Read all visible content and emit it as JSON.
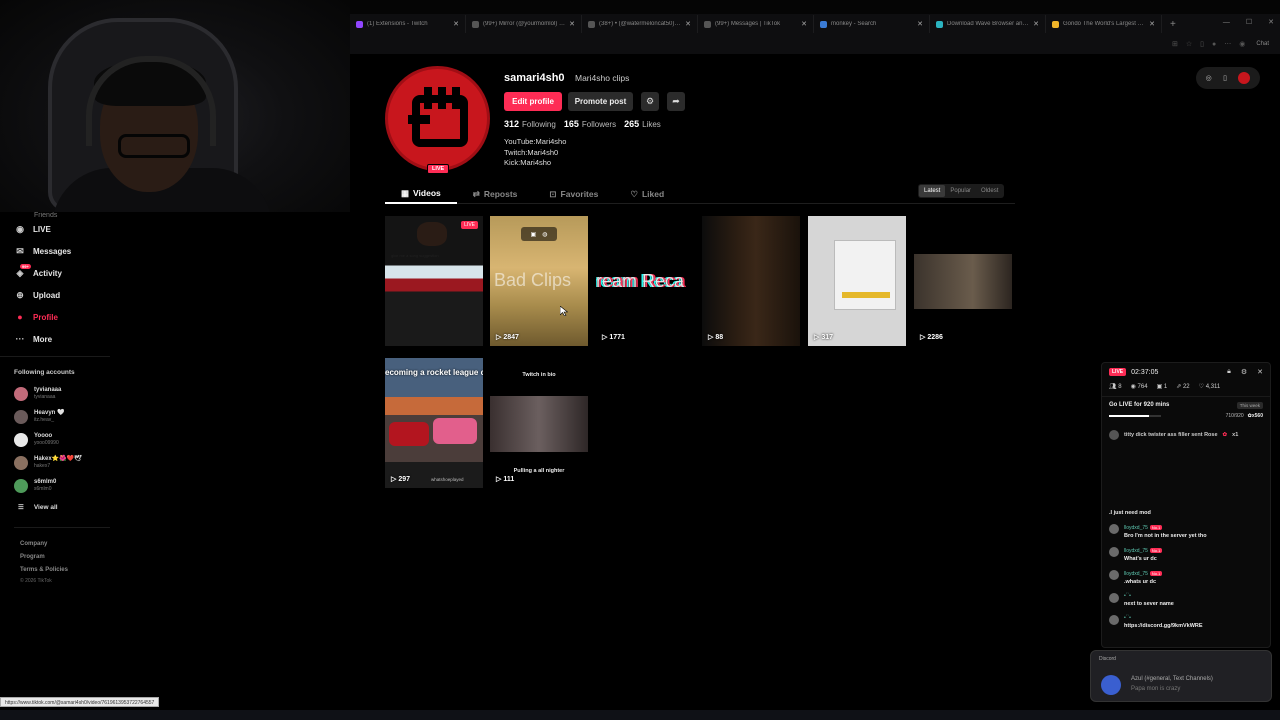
{
  "browser": {
    "tabs": [
      {
        "title": "(1) Extensions - Twitch",
        "color": "#9146ff"
      },
      {
        "title": "(99+) Mirror (@yourmomlol) | TikTok",
        "color": "#555555"
      },
      {
        "title": "(38+) • (@watermeloncat50) | TikTok",
        "color": "#555555"
      },
      {
        "title": "(99+) Messages | TikTok",
        "color": "#555555"
      },
      {
        "title": "monkey - Search",
        "color": "#3a7bd5"
      },
      {
        "title": "Download Wave Browser and Cl...",
        "color": "#2bb3c0"
      },
      {
        "title": "Gondo The World's Largest Sod...",
        "color": "#f0b429"
      }
    ],
    "new_tab": "+",
    "chat_ext": "Chat"
  },
  "sidebar": {
    "friends_label": "Friends",
    "items": [
      {
        "label": "LIVE",
        "icon": "live-icon"
      },
      {
        "label": "Messages",
        "icon": "messages-icon"
      },
      {
        "label": "Activity",
        "icon": "activity-icon",
        "badge": "99+"
      },
      {
        "label": "Upload",
        "icon": "upload-icon"
      },
      {
        "label": "Profile",
        "icon": "profile-icon",
        "active": true
      },
      {
        "label": "More",
        "icon": "more-icon"
      }
    ],
    "following_label": "Following accounts",
    "accounts": [
      {
        "name": "tyvianaaa",
        "handle": "tyvianaaa",
        "color": "#c26b7a"
      },
      {
        "name": "Heavyn 🤍",
        "handle": "itz.heav_",
        "color": "#6a5a5a"
      },
      {
        "name": "Yoooo",
        "handle": "yooo09990",
        "color": "#e8e8e8"
      },
      {
        "name": "Hakex⭐🌺❤️🕊",
        "handle": "hakex7",
        "color": "#8a7060"
      },
      {
        "name": "s6mlm0",
        "handle": "s6mlm0",
        "color": "#4e9a5a"
      }
    ],
    "view_all": "View all",
    "footer": {
      "company": "Company",
      "program": "Program",
      "terms": "Terms & Policies",
      "copyright": "© 2026 TikTok"
    }
  },
  "profile": {
    "username": "samari4sh0",
    "nickname": "Mari4sho clips",
    "live_badge": "LIVE",
    "edit_button": "Edit profile",
    "promote_button": "Promote post",
    "following_count": "312",
    "following_label": "Following",
    "followers_count": "165",
    "followers_label": "Followers",
    "likes_count": "265",
    "likes_label": "Likes",
    "bio": [
      "YouTube:Mari4sho",
      "Twitch:Mari4sh0",
      "Kick:Mari4sho"
    ]
  },
  "tabs": [
    {
      "label": "Videos",
      "icon": "grid-icon",
      "active": true
    },
    {
      "label": "Reposts",
      "icon": "repost-icon"
    },
    {
      "label": "Favorites",
      "icon": "bookmark-icon"
    },
    {
      "label": "Liked",
      "icon": "heart-icon"
    }
  ],
  "sort": {
    "latest": "Latest",
    "popular": "Popular",
    "oldest": "Oldest",
    "selected": "Latest"
  },
  "videos": [
    {
      "views": "",
      "caption": "give me a song suggestion",
      "live": "LIVE"
    },
    {
      "views": "2847",
      "overlay": "Bad Clips"
    },
    {
      "views": "1771",
      "overlay": "ream Reca"
    },
    {
      "views": "88"
    },
    {
      "views": "317"
    },
    {
      "views": "2286"
    },
    {
      "views": "297",
      "overlay": "ecoming a rocket league chud??",
      "sub": "whatshoeplayed"
    },
    {
      "views": "111",
      "top": "Twitch in bio",
      "bottom": "Pulling a all nighter"
    }
  ],
  "live_panel": {
    "badge": "LIVE",
    "timer": "02:37:05",
    "stats": {
      "viewers": "8",
      "views": "764",
      "gifts": "1",
      "shares": "22",
      "likes": "4,311"
    },
    "goal": {
      "title": "Go LIVE for 920 mins",
      "period": "This week",
      "progress": "710/920",
      "fraction": 0.77,
      "reward": "x560"
    },
    "gift": {
      "text": "titty dick twister ass filler sent Rose",
      "count": "x1"
    },
    "messages": [
      {
        "user": "",
        "text": ".I just need mod"
      },
      {
        "user": "lloydxd_75",
        "tag": "No.1",
        "text": "Bro I'm not in the server yet tho"
      },
      {
        "user": "lloydxd_75",
        "tag": "No.1",
        "text": "What's ur dc"
      },
      {
        "user": "lloydxd_75",
        "tag": "No.1",
        "text": ".whats ur dc"
      },
      {
        "user": "•ˊˋ•",
        "tag": "",
        "text": "next to sever name"
      },
      {
        "user": "•ˊˋ•",
        "tag": "",
        "text": "https://discord.gg/9kmVkWRE"
      }
    ]
  },
  "toast": {
    "app": "Discord",
    "title": "Azul (#general, Text Channels)",
    "body": "Papa mon is crazy"
  },
  "status_url": "https://www.tiktok.com/@samari4sh0/video/7619613953722764557",
  "colors": {
    "accent": "#fe2c55",
    "background": "#000000",
    "teal": "#25f4ee"
  }
}
